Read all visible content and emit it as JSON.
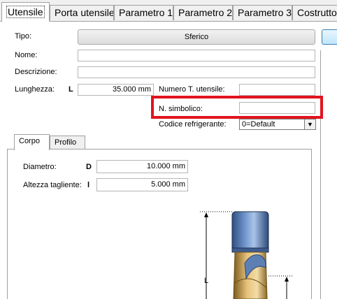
{
  "tabs": [
    "Utensile",
    "Porta utensile",
    "Parametro 1",
    "Parametro 2",
    "Parametro 3",
    "Costruttore"
  ],
  "form": {
    "tipo_label": "Tipo:",
    "tipo_button": "Sferico",
    "nome_label": "Nome:",
    "nome_value": "",
    "descrizione_label": "Descrizione:",
    "descrizione_value": "",
    "lunghezza_label": "Lunghezza:",
    "lunghezza_symbol": "L",
    "lunghezza_value": "35.000 mm",
    "numero_label": "Numero T. utensile:",
    "numero_value": "",
    "simbolico_label": "N. simbolico:",
    "simbolico_value": "",
    "refrigerante_label": "Codice refrigerante:",
    "refrigerante_value": "0=Default"
  },
  "subtabs": [
    "Corpo",
    "Profilo"
  ],
  "corpo": {
    "diametro_label": "Diametro:",
    "diametro_symbol": "D",
    "diametro_value": "10.000 mm",
    "altezza_label": "Altezza tagliente:",
    "altezza_symbol": "l",
    "altezza_value": "5.000 mm",
    "dim_label": "L"
  },
  "colors": {
    "highlight": "#e0141f",
    "tool_shank": "#5a7fb8",
    "tool_flute": "#c9a34a"
  }
}
